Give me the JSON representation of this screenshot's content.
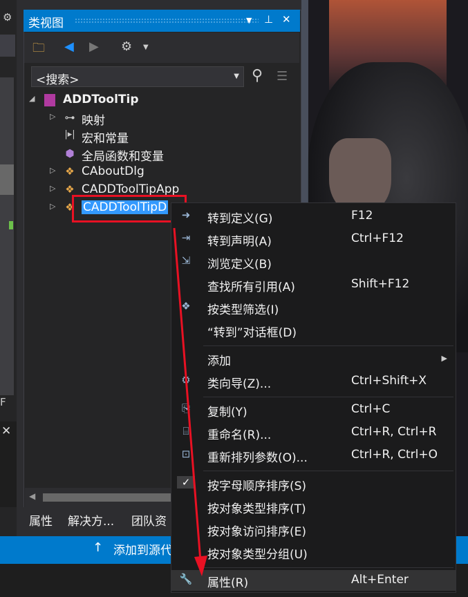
{
  "panel": {
    "title": "类视图",
    "search_placeholder": "<搜索>",
    "tree": [
      {
        "label": "ADDToolTip",
        "icon": "class-view-project-icon"
      },
      {
        "label": "映射",
        "icon": "key-map-icon"
      },
      {
        "label": "宏和常量",
        "icon": "macro-constants-icon"
      },
      {
        "label": "全局函数和变量",
        "icon": "cube-icon"
      },
      {
        "label": "CAboutDlg",
        "icon": "class-icon"
      },
      {
        "label": "CADDToolTipApp",
        "icon": "class-icon"
      },
      {
        "label": "CADDToolTipD",
        "icon": "class-icon"
      }
    ],
    "bottom_tabs": [
      "属性",
      "解决方...",
      "团队资"
    ],
    "status_text": "添加到源代"
  },
  "left_strip": {
    "letter": "F"
  },
  "context_menu": {
    "groups": [
      [
        {
          "label": "转到定义(G)",
          "shortcut": "F12",
          "icon": "go-to-definition-icon"
        },
        {
          "label": "转到声明(A)",
          "shortcut": "Ctrl+F12",
          "icon": "go-to-declaration-icon"
        },
        {
          "label": "浏览定义(B)",
          "shortcut": "",
          "icon": "peek-definition-icon"
        },
        {
          "label": "查找所有引用(A)",
          "shortcut": "Shift+F12",
          "icon": ""
        },
        {
          "label": "按类型筛选(I)",
          "shortcut": "",
          "icon": "filter-type-icon"
        },
        {
          "label": "“转到”对话框(D)",
          "shortcut": "",
          "icon": ""
        }
      ],
      [
        {
          "label": "添加",
          "shortcut": "",
          "icon": "",
          "submenu": true
        },
        {
          "label": "类向导(Z)...",
          "shortcut": "Ctrl+Shift+X",
          "icon": "class-wizard-icon"
        }
      ],
      [
        {
          "label": "复制(Y)",
          "shortcut": "Ctrl+C",
          "icon": "copy-icon"
        },
        {
          "label": "重命名(R)...",
          "shortcut": "Ctrl+R, Ctrl+R",
          "icon": "rename-icon"
        },
        {
          "label": "重新排列参数(O)...",
          "shortcut": "Ctrl+R, Ctrl+O",
          "icon": "reorder-params-icon"
        }
      ],
      [
        {
          "label": "按字母顺序排序(S)",
          "shortcut": "",
          "icon": "checkmark-icon"
        },
        {
          "label": "按对象类型排序(T)",
          "shortcut": "",
          "icon": ""
        },
        {
          "label": "按对象访问排序(E)",
          "shortcut": "",
          "icon": ""
        },
        {
          "label": "按对象类型分组(U)",
          "shortcut": "",
          "icon": ""
        }
      ],
      [
        {
          "label": "属性(R)",
          "shortcut": "Alt+Enter",
          "icon": "wrench-icon",
          "highlighted": true
        }
      ]
    ]
  },
  "colors": {
    "accent": "#007acc",
    "annotation": "#e81123",
    "selection": "#3399ff"
  }
}
